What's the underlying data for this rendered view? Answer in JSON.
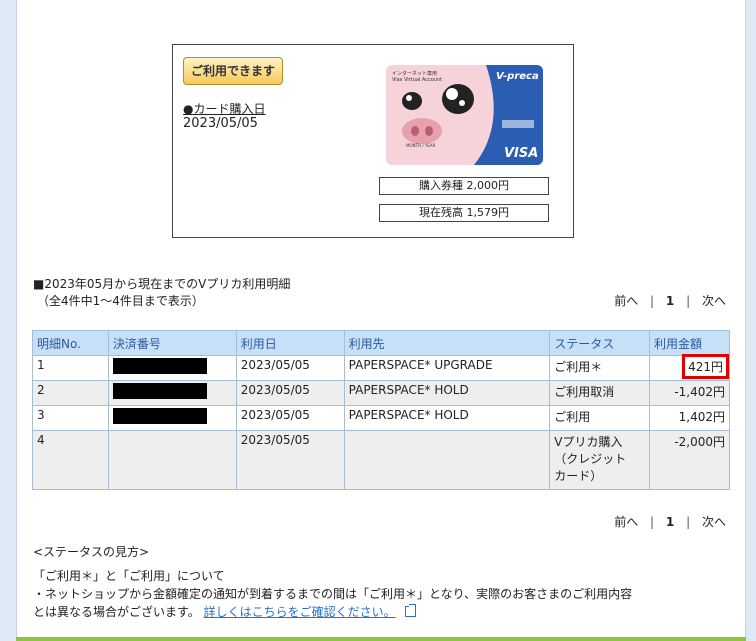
{
  "card": {
    "status_button": "ご利用できます",
    "purchase_date_label": "●カード購入日",
    "purchase_date": "2023/05/05",
    "purchase_amount": "購入券種  2,000円",
    "balance": "現在残高  1,579円",
    "image": {
      "brand": "V-preca",
      "subtitle_line1": "インターネット専用",
      "subtitle_line2": "Visa Virtual Account",
      "network": "VISA",
      "expiry_label": "MONTH / YEAR"
    }
  },
  "statement": {
    "heading": "■2023年05月から現在までのVプリカ利用明細",
    "subheading": "（全4件中1～4件目まで表示）",
    "pager": {
      "prev": "前へ",
      "current": "1",
      "next": "次へ",
      "sep": "|"
    },
    "columns": [
      "明細No.",
      "決済番号",
      "利用日",
      "利用先",
      "ステータス",
      "利用金額"
    ],
    "rows": [
      {
        "no": "1",
        "date": "2023/05/05",
        "merchant": "PAPERSPACE* UPGRADE",
        "status": "ご利用＊",
        "amount": "421円"
      },
      {
        "no": "2",
        "date": "2023/05/05",
        "merchant": "PAPERSPACE* HOLD",
        "status": "ご利用取消",
        "amount": "-1,402円"
      },
      {
        "no": "3",
        "date": "2023/05/05",
        "merchant": "PAPERSPACE* HOLD",
        "status": "ご利用",
        "amount": "1,402円"
      },
      {
        "no": "4",
        "date": "2023/05/05",
        "merchant": "",
        "status_line1": "Vプリカ購入",
        "status_line2": "（クレジット",
        "status_line3": "カード）",
        "amount": "-2,000円"
      }
    ]
  },
  "legend": {
    "title": "<ステータスの見方>",
    "line1": "「ご利用＊」と「ご利用」について",
    "line2": "・ネットショップから金額確定の通知が到着するまでの間は「ご利用＊」となり、実際のお客さまのご利用内容",
    "line3_text": "とは異なる場合がございます。",
    "line3_link": "詳しくはこちらをご確認ください。"
  },
  "colors": {
    "header_bg": "#c8e0f7",
    "header_text": "#2a5aa0",
    "highlight": "#e00000",
    "link": "#2a6fcf"
  }
}
